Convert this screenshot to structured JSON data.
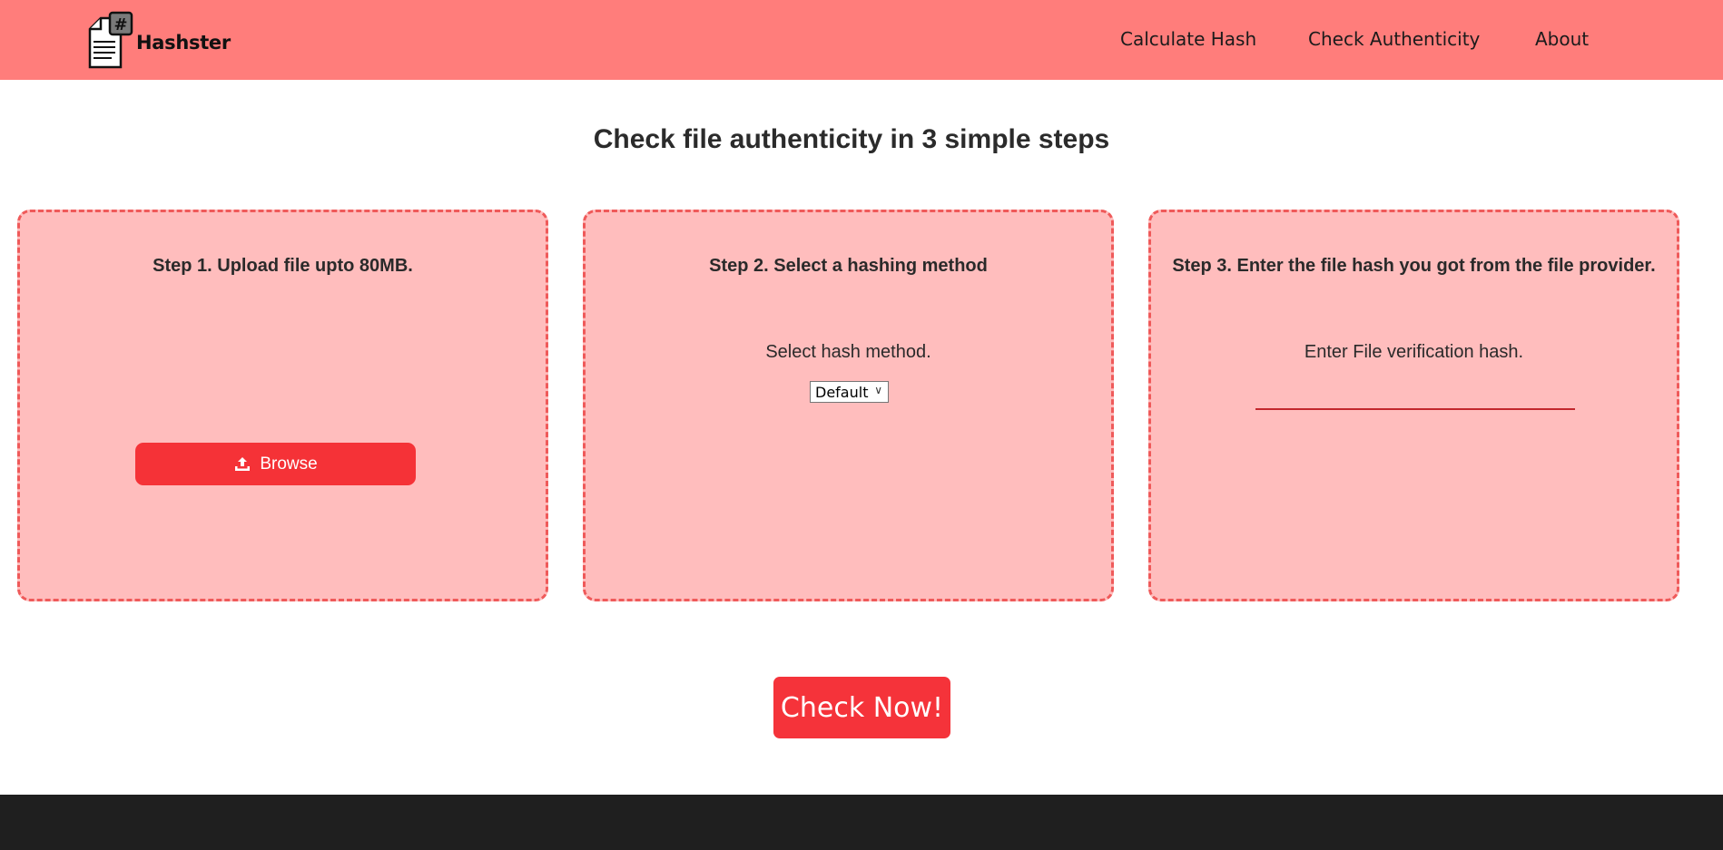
{
  "header": {
    "brand": "Hashster",
    "nav": [
      {
        "label": "Calculate Hash"
      },
      {
        "label": "Check Authenticity"
      },
      {
        "label": "About"
      }
    ],
    "colors": {
      "background": "#ff7d7b"
    }
  },
  "main": {
    "title": "Check file authenticity in 3 simple steps",
    "steps": [
      {
        "title": "Step 1. Upload file upto 80MB.",
        "button_label": "Browse",
        "icon": "upload-icon"
      },
      {
        "title": "Step 2. Select a hashing method",
        "label": "Select hash method.",
        "select_value": "Default"
      },
      {
        "title": "Step 3. Enter the file hash you got from the file provider.",
        "label": "Enter File verification hash.",
        "input_value": ""
      }
    ],
    "check_button": "Check Now!",
    "colors": {
      "card_bg": "#ffbdbd",
      "card_border": "#ef5a5a",
      "accent": "#f53237"
    }
  },
  "footer": {
    "colors": {
      "background": "#1f1f1f"
    }
  }
}
